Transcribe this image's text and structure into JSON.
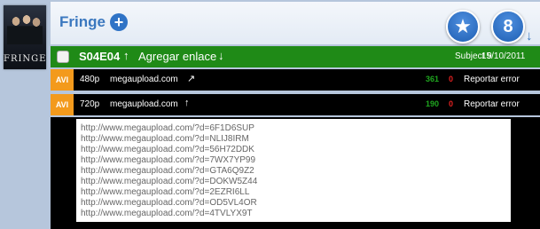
{
  "poster": {
    "title": "FRINGE"
  },
  "header": {
    "title": "Fringe",
    "add_icon": "+",
    "star_icon": "★",
    "count": "8",
    "arrow_icon": "↓"
  },
  "episode": {
    "code": "S04E04",
    "up_arrow": "↑",
    "add_link_label": "Agregar enlace",
    "down_arrow": "↓",
    "subject": "Subject 9",
    "date": "15/10/2011",
    "color": "#1f8a17"
  },
  "links": [
    {
      "format": "AVI",
      "quality": "480p",
      "host": "megaupload.com",
      "arrow": "↗",
      "up_count": "361",
      "down_count": "0",
      "report": "Reportar error"
    },
    {
      "format": "AVI",
      "quality": "720p",
      "host": "megaupload.com",
      "arrow": "↑",
      "up_count": "190",
      "down_count": "0",
      "report": "Reportar error"
    }
  ],
  "urls": [
    "http://www.megaupload.com/?d=6F1D6SUP",
    "http://www.megaupload.com/?d=NLIJ8IRM",
    "http://www.megaupload.com/?d=56H72DDK",
    "http://www.megaupload.com/?d=7WX7YP99",
    "http://www.megaupload.com/?d=GTA6Q9Z2",
    "http://www.megaupload.com/?d=DOKW5Z44",
    "http://www.megaupload.com/?d=2EZRI6LL",
    "http://www.megaupload.com/?d=OD5VL4OR",
    "http://www.megaupload.com/?d=4TVLYX9T"
  ]
}
